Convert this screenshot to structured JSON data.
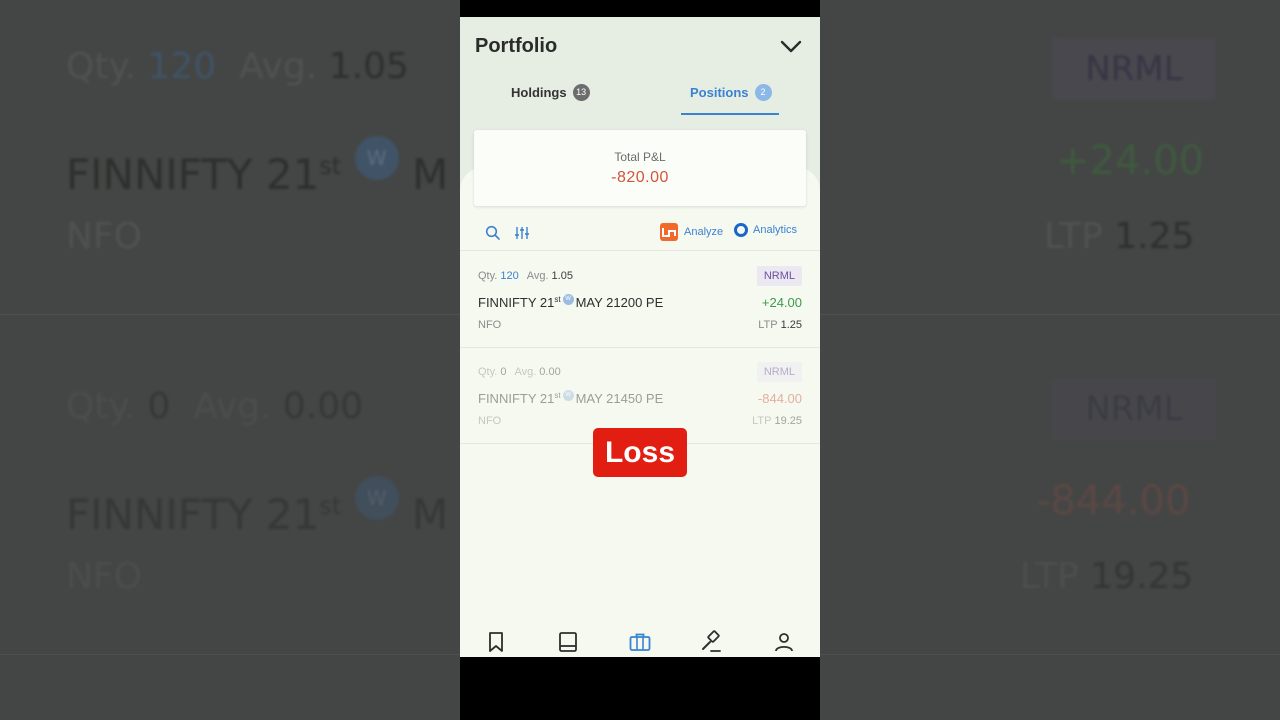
{
  "background": {
    "rows": [
      {
        "qty_label": "Qty.",
        "qty": "120",
        "avg_label": "Avg.",
        "avg": "1.05",
        "product": "NRML",
        "symbol": "FINNIFTY 21",
        "sup": "st",
        "w": "W",
        "month_initial": "M",
        "pnl": "+24.00",
        "exchange": "NFO",
        "ltp_label": "LTP",
        "ltp": "1.25"
      },
      {
        "qty_label": "Qty.",
        "qty": "0",
        "avg_label": "Avg.",
        "avg": "0.00",
        "product": "NRML",
        "symbol": "FINNIFTY 21",
        "sup": "st",
        "w": "W",
        "month_initial": "M",
        "pnl": "-844.00",
        "exchange": "NFO",
        "ltp_label": "LTP",
        "ltp": "19.25"
      }
    ]
  },
  "header": {
    "title": "Portfolio"
  },
  "tabs": [
    {
      "label": "Holdings",
      "count": "13"
    },
    {
      "label": "Positions",
      "count": "2"
    }
  ],
  "pnl": {
    "label": "Total P&L",
    "value": "-820.00"
  },
  "toolbar": {
    "analyze_label": "Analyze",
    "analytics_label": "Analytics"
  },
  "positions": [
    {
      "qty_label": "Qty.",
      "qty": "120",
      "avg_label": "Avg.",
      "avg": "1.05",
      "product": "NRML",
      "symbol": "FINNIFTY 21",
      "sup": "st",
      "w": "W",
      "rest": "MAY 21200 PE",
      "pnl": "+24.00",
      "exchange": "NFO",
      "ltp_label": "LTP",
      "ltp": "1.25"
    },
    {
      "qty_label": "Qty.",
      "qty": "0",
      "avg_label": "Avg.",
      "avg": "0.00",
      "product": "NRML",
      "symbol": "FINNIFTY 21",
      "sup": "st",
      "w": "W",
      "rest": "MAY 21450 PE",
      "pnl": "-844.00",
      "exchange": "NFO",
      "ltp_label": "LTP",
      "ltp": "19.25"
    }
  ],
  "overlay": {
    "loss_label": "Loss"
  },
  "nav": [
    "bookmark-icon",
    "book-icon",
    "briefcase-icon",
    "gavel-icon",
    "user-icon"
  ],
  "colors": {
    "accent": "#3b82d1",
    "profit": "#3d9b4a",
    "loss": "#d4533b",
    "loss_tag": "#e21d12"
  }
}
